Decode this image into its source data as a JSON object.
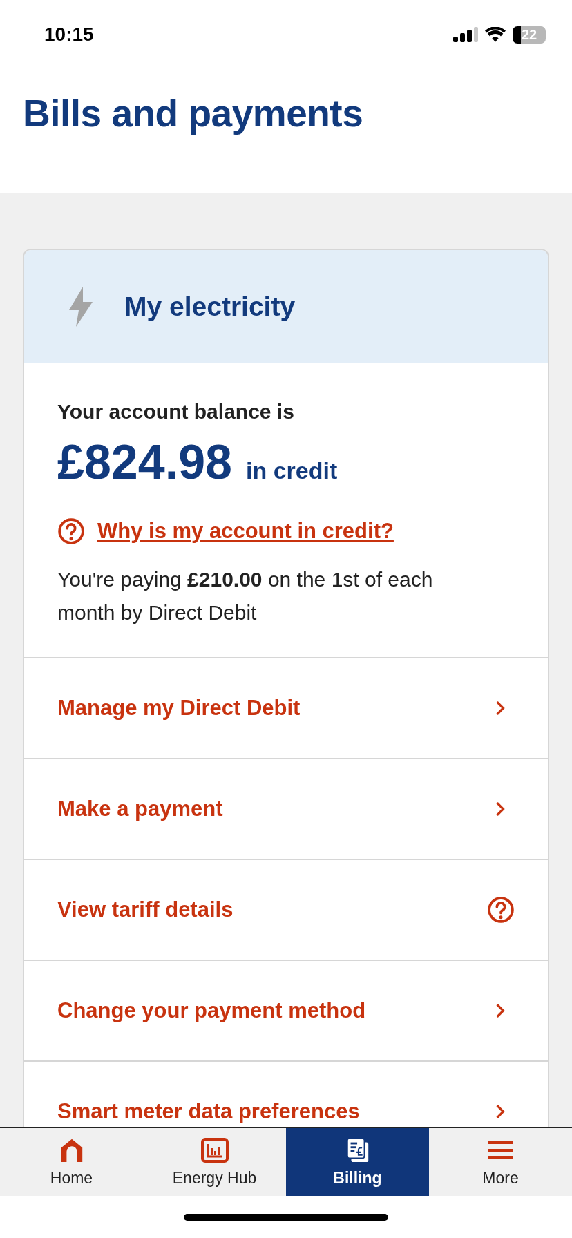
{
  "status_bar": {
    "time": "10:15",
    "battery": "22"
  },
  "page_title": "Bills and payments",
  "account_card": {
    "title": "My electricity",
    "balance_label": "Your account balance is",
    "balance": "£824.98",
    "balance_state": "in credit",
    "help_link": "Why is my account in credit?",
    "payment_text": "You're paying **£210.00** on the 1st of each month by Direct Debit"
  },
  "menu_items": [
    {
      "label": "Manage my Direct Debit",
      "kind": "chevron"
    },
    {
      "label": "Make a payment",
      "kind": "chevron"
    },
    {
      "label": "View tariff details",
      "kind": "help"
    },
    {
      "label": "Change your payment method",
      "kind": "chevron"
    },
    {
      "label": "Smart meter data preferences",
      "kind": "chevron"
    }
  ],
  "tab_bar": [
    {
      "label": "Home",
      "kind": "home",
      "selected": false
    },
    {
      "label": "Energy Hub",
      "kind": "chart",
      "selected": false
    },
    {
      "label": "Billing",
      "kind": "bill",
      "selected": true
    },
    {
      "label": "More",
      "kind": "menu",
      "selected": false
    }
  ]
}
